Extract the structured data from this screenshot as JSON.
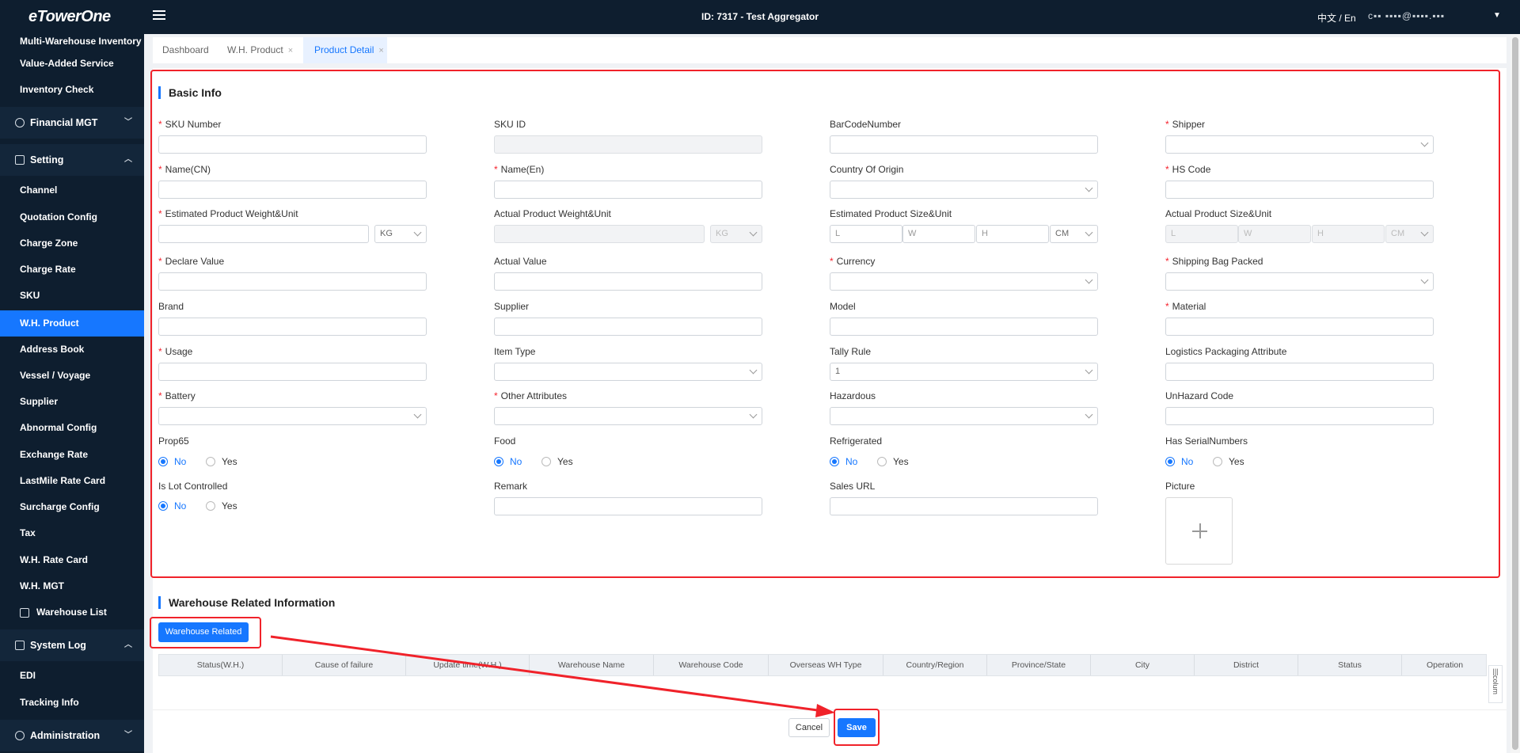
{
  "topbar": {
    "logo": "eTowerOne",
    "title": "ID: 7317 - Test Aggregator",
    "lang": "中文 / En",
    "user": "c▪▪ ▪▪▪▪@▪▪▪▪.▪▪▪"
  },
  "sidebar": {
    "items": [
      {
        "label": "Multi-Warehouse Inventory"
      },
      {
        "label": "Value-Added Service"
      },
      {
        "label": "Inventory Check"
      },
      {
        "label": "Channel"
      },
      {
        "label": "Quotation Config"
      },
      {
        "label": "Charge Zone"
      },
      {
        "label": "Charge Rate"
      },
      {
        "label": "SKU"
      },
      {
        "label": "W.H. Product"
      },
      {
        "label": "Address Book"
      },
      {
        "label": "Vessel / Voyage"
      },
      {
        "label": "Supplier"
      },
      {
        "label": "Abnormal Config"
      },
      {
        "label": "Exchange Rate"
      },
      {
        "label": "LastMile Rate Card"
      },
      {
        "label": "Surcharge Config"
      },
      {
        "label": "Tax"
      },
      {
        "label": "W.H. Rate Card"
      },
      {
        "label": "W.H. MGT"
      },
      {
        "label": "Warehouse List"
      },
      {
        "label": "EDI"
      },
      {
        "label": "Tracking Info"
      }
    ],
    "groups": [
      {
        "label": "Financial MGT"
      },
      {
        "label": "Setting"
      },
      {
        "label": "System Log"
      },
      {
        "label": "Administration"
      }
    ],
    "active": "W.H. Product"
  },
  "tabs": [
    {
      "label": "Dashboard"
    },
    {
      "label": "W.H. Product"
    },
    {
      "label": "Product Detail"
    }
  ],
  "basic_info": {
    "title": "Basic Info",
    "fields": {
      "sku_number": "SKU Number",
      "sku_id": "SKU ID",
      "barcode": "BarCodeNumber",
      "shipper": "Shipper",
      "name_cn": "Name(CN)",
      "name_en": "Name(En)",
      "country_of_origin": "Country Of Origin",
      "hs_code": "HS Code",
      "est_weight": "Estimated Product Weight&Unit",
      "act_weight": "Actual Product Weight&Unit",
      "est_size": "Estimated Product Size&Unit",
      "act_size": "Actual Product Size&Unit",
      "declare_value": "Declare Value",
      "actual_value": "Actual Value",
      "currency": "Currency",
      "shipping_bag": "Shipping Bag Packed",
      "brand": "Brand",
      "supplier": "Supplier",
      "model": "Model",
      "material": "Material",
      "usage": "Usage",
      "item_type": "Item Type",
      "tally_rule": "Tally Rule",
      "logistics_packaging": "Logistics Packaging Attribute",
      "battery": "Battery",
      "other_attributes": "Other Attributes",
      "hazardous": "Hazardous",
      "unhazard_code": "UnHazard Code",
      "prop65": "Prop65",
      "food": "Food",
      "refrigerated": "Refrigerated",
      "has_serial": "Has SerialNumbers",
      "is_lot": "Is Lot Controlled",
      "remark": "Remark",
      "sales_url": "Sales URL",
      "picture": "Picture"
    },
    "values": {
      "weight_unit": "KG",
      "size_unit": "CM",
      "size_l": "L",
      "size_w": "W",
      "size_h": "H",
      "tally_rule": "1",
      "no": "No",
      "yes": "Yes"
    }
  },
  "warehouse_info": {
    "title": "Warehouse Related Information",
    "button": "Warehouse Related",
    "columns": [
      "Status(W.H.)",
      "Cause of failure",
      "Update time(W.H.)",
      "Warehouse Name",
      "Warehouse Code",
      "Overseas WH Type",
      "Country/Region",
      "Province/State",
      "City",
      "District",
      "Status",
      "Operation"
    ],
    "column_settings": "colum"
  },
  "footer": {
    "cancel": "Cancel",
    "save": "Save"
  },
  "colors": {
    "primary": "#1677ff",
    "sidebar_bg": "#0e1e2f",
    "annotation_red": "#f0222a"
  }
}
